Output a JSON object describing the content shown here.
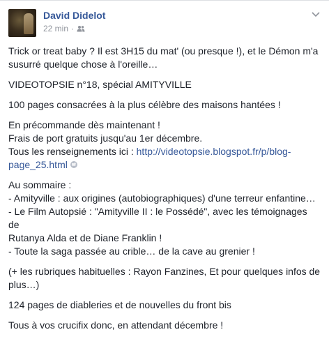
{
  "header": {
    "author": "David Didelot",
    "time": "22 min",
    "separator": "·",
    "audience_icon": "friends-icon",
    "menu_icon": "chevron-down-icon"
  },
  "post": {
    "intro_line1": "Trick or treat baby ? Il est 3H15 du mat' (ou presque !), et le Démon m'a",
    "intro_line2": "susurré quelque chose à l'oreille…",
    "title": "VIDEOTOPSIE n°18, spécial AMITYVILLE",
    "pages": "100 pages consacrées à la plus célèbre des maisons hantées !",
    "preorder": "En précommande dès maintenant !",
    "shipping": "Frais de port gratuits jusqu'au 1er décembre.",
    "info_prefix": "Tous les renseignements ici : ",
    "info_link_line1": "http://videotopsie.blogspot.fr/p/blog-",
    "info_link_line2": "page_25.html",
    "summary_title": "Au sommaire :",
    "summary_item1": "- Amityville : aux origines (autobiographiques) d'une terreur enfantine…",
    "summary_item2_line1": "- Le Film Autopsié : \"Amityville II : le Possédé\", avec les témoignages de",
    "summary_item2_line2": "Rutanya Alda et de Diane Franklin !",
    "summary_item3": "- Toute la saga passée au crible… de la cave au grenier !",
    "rubriques_line1": "(+ les rubriques habituelles : Rayon Fanzines, Et pour quelques infos de",
    "rubriques_line2": "plus…)",
    "extra": "124 pages de diableries et de nouvelles du front bis",
    "closing": "Tous à vos crucifix donc, en attendant décembre !"
  },
  "colors": {
    "author": "#365899",
    "link": "#365899",
    "meta": "#90949c",
    "text": "#1d2129"
  }
}
